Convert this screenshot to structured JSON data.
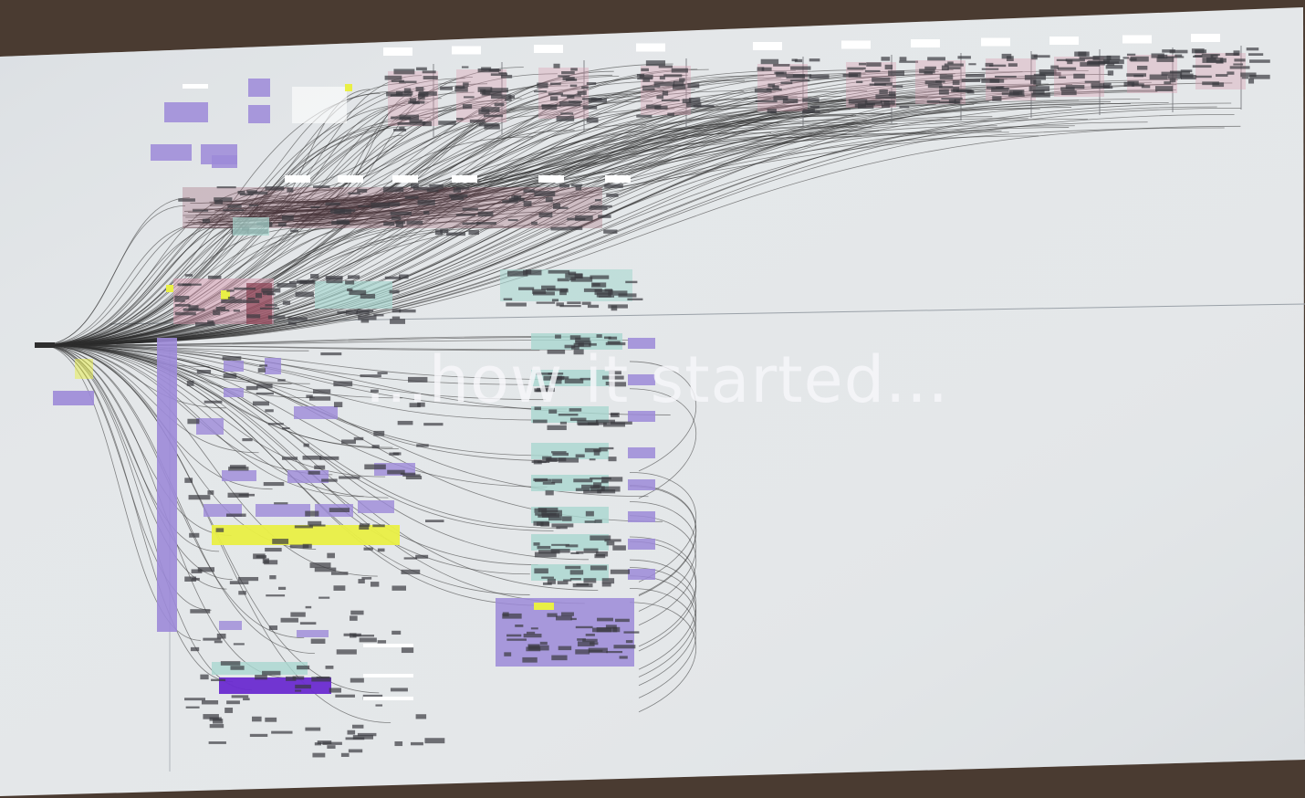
{
  "photo": {
    "subject": "photo of a projected screen showing a large node-graph canvas",
    "overlay_caption": "...how it started..."
  },
  "colors": {
    "surround": "#4a3b31",
    "screen": "#e6e9eb",
    "group_purple": "#9c8ad8",
    "group_teal": "#a9d7d0",
    "group_yellow": "#e9ef45",
    "group_pink": "#d99ab0",
    "group_maroon": "#8a4152",
    "wire": "#2e2e2e"
  },
  "nodes": {
    "top_row_groups": 11,
    "left_column_groups": 18,
    "right_column_groups": 8
  }
}
